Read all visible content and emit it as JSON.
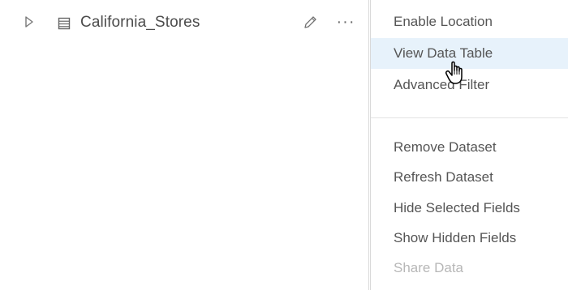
{
  "dataset": {
    "name": "California_Stores",
    "icons": {
      "expand": "expand-triangle-icon",
      "table": "data-table-icon",
      "edit": "pencil-icon",
      "more": "ellipsis-icon"
    },
    "more_glyph": "···"
  },
  "menu": {
    "items": [
      {
        "label": "Enable Location",
        "enabled": true
      },
      {
        "label": "View Data Table",
        "enabled": true,
        "highlighted": true
      },
      {
        "label": "Advanced Filter",
        "enabled": true
      },
      {
        "label": "Remove Dataset",
        "enabled": true
      },
      {
        "label": "Refresh Dataset",
        "enabled": true
      },
      {
        "label": "Hide Selected Fields",
        "enabled": true
      },
      {
        "label": "Show Hidden Fields",
        "enabled": true
      },
      {
        "label": "Share Data",
        "enabled": false
      }
    ]
  },
  "colors": {
    "text": "#555555",
    "disabled_text": "#b7b7b7",
    "highlight_background": "#e7f2fb",
    "border": "#d9d9d9"
  }
}
